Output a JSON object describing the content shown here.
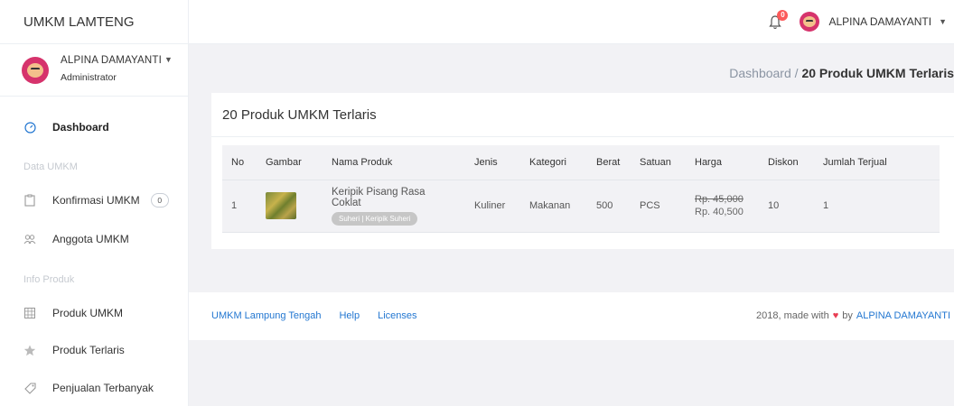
{
  "app": {
    "brand": "UMKM LAMTENG"
  },
  "topbar": {
    "notification_count": "0",
    "user_name": "ALPINA DAMAYANTI"
  },
  "sidebar": {
    "profile": {
      "name": "ALPINA DAMAYANTI",
      "role": "Administrator"
    },
    "dashboard": "Dashboard",
    "section_data": "Data UMKM",
    "konfirmasi": "Konfirmasi UMKM",
    "konfirmasi_count": "0",
    "anggota": "Anggota UMKM",
    "section_info": "Info Produk",
    "produk": "Produk UMKM",
    "terlaris": "Produk Terlaris",
    "penjualan": "Penjualan Terbanyak"
  },
  "breadcrumb": {
    "parent": "Dashboard",
    "separator": " / ",
    "current": "20 Produk UMKM Terlaris"
  },
  "card": {
    "title": "20 Produk UMKM Terlaris"
  },
  "table": {
    "headers": [
      "No",
      "Gambar",
      "Nama Produk",
      "Jenis",
      "Kategori",
      "Berat",
      "Satuan",
      "Harga",
      "Diskon",
      "Jumlah Terjual"
    ],
    "rows": [
      {
        "no": "1",
        "nama": "Keripik Pisang Rasa Coklat",
        "tag": "Suheri | Keripik Suheri",
        "jenis": "Kuliner",
        "kategori": "Makanan",
        "berat": "500",
        "satuan": "PCS",
        "harga_lama": "Rp. 45,000",
        "harga_baru": "Rp. 40,500",
        "diskon": "10",
        "terjual": "1"
      }
    ]
  },
  "footer": {
    "link1": "UMKM Lampung Tengah",
    "link2": "Help",
    "link3": "Licenses",
    "made_prefix": "2018, made with",
    "made_by": "by",
    "author": "ALPINA DAMAYANTI"
  },
  "colors": {
    "accent": "#2377d1",
    "badge": "#fc5a5a",
    "heart": "#e83d52"
  }
}
